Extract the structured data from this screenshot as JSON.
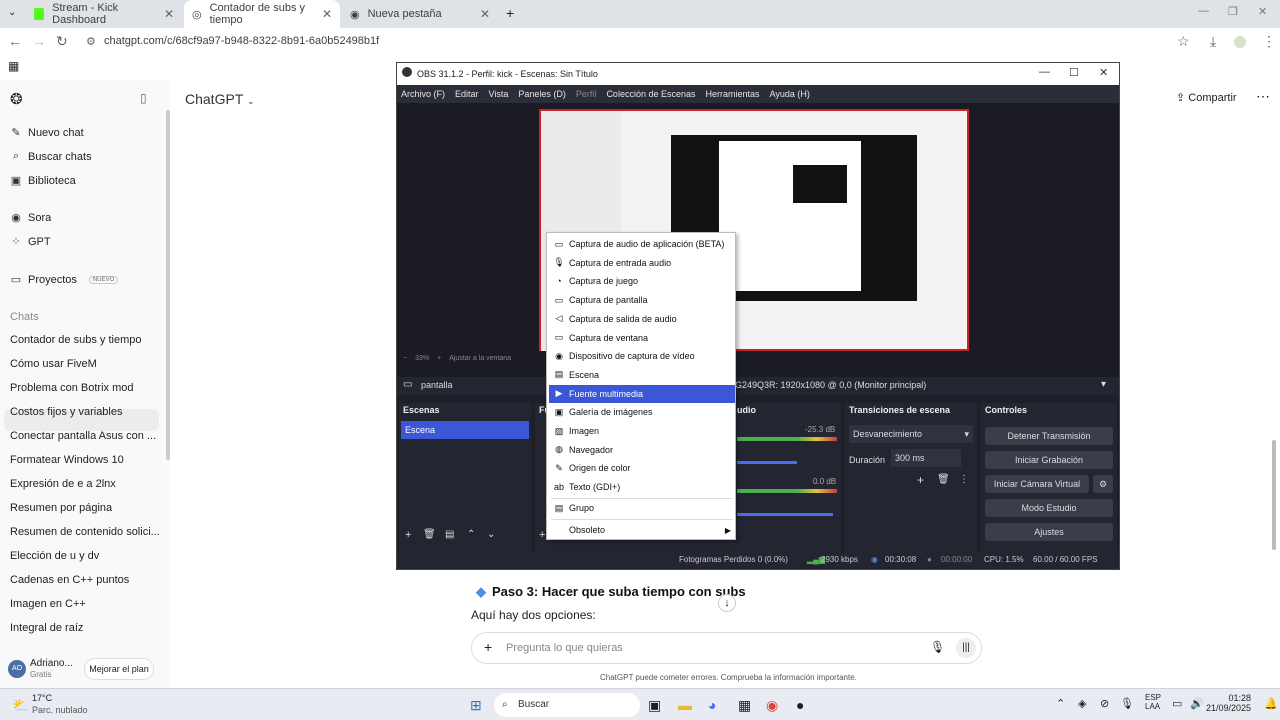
{
  "browser": {
    "tabs": [
      {
        "label": "Stream - Kick Dashboard"
      },
      {
        "label": "Contador de subs y tiempo"
      },
      {
        "label": "Nueva pestaña"
      }
    ],
    "url": "chatgpt.com/c/68cf9a97-b948-8322-8b91-6a0b52498b1f"
  },
  "chatgpt": {
    "title": "ChatGPT",
    "share": "Compartir",
    "sidebar": {
      "new_chat": "Nuevo chat",
      "search_chats": "Buscar chats",
      "library": "Biblioteca",
      "sora": "Sora",
      "gpt": "GPT",
      "projects": "Proyectos",
      "projects_badge": "NUEVO",
      "chats_heading": "Chats",
      "chats": [
        "Contador de subs y tiempo",
        "Cómo usar FiveM",
        "Problema con Botrix mod",
        "Costos fijos y variables",
        "Conectar pantalla Asus con ...",
        "Formatear Windows 10",
        "Expresión de e a 2lnx",
        "Resumen por página",
        "Resumen de contenido solici...",
        "Elección de u y dv",
        "Cadenas en C++ puntos",
        "Imagen en C++",
        "Integral de raíz"
      ],
      "user_initials": "AO",
      "user_name": "Adriano...",
      "user_plan": "Gratis",
      "upgrade": "Mejorar el plan"
    },
    "content": {
      "step_heading": "Paso 3: Hacer que suba tiempo con subs",
      "options_text": "Aquí hay dos opciones:",
      "composer_placeholder": "Pregunta lo que quieras",
      "disclaimer": "ChatGPT puede cometer errores. Comprueba la información importante."
    }
  },
  "obs": {
    "title": "OBS 31.1.2 - Perfil: kick - Escenas: Sin Título",
    "menu": [
      "Archivo (F)",
      "Editar",
      "Vista",
      "Paneles (D)",
      "Perfil",
      "Colección de Escenas",
      "Herramientas",
      "Ayuda (H)"
    ],
    "zoom": "33%",
    "fit": "Ajustar a la ventana",
    "source_name": "pantalla",
    "monitor": "G249Q3R: 1920x1080 @ 0,0 (Monitor principal)",
    "scenes_header": "Escenas",
    "scene_item": "Escena",
    "sources_header": "Fu",
    "audio_header": "udio",
    "audio_db1": "-25.3 dB",
    "audio_db2": "0.0 dB",
    "transitions_header": "Transiciones de escena",
    "transition": "Desvanecimiento",
    "duration_label": "Duración",
    "duration_value": "300 ms",
    "controls_header": "Controles",
    "controls": {
      "stop_stream": "Detener Transmisión",
      "start_recording": "Iniciar Grabación",
      "virtual_cam": "Iniciar Cámara Virtual",
      "studio_mode": "Modo Estudio",
      "settings": "Ajustes"
    },
    "status": {
      "dropped": "Fotogramas Perdidos 0 (0.0%)",
      "bitrate": "2930 kbps",
      "stream_time": "00:30:08",
      "rec_time": "00:00:00",
      "cpu": "CPU: 1.5%",
      "fps": "60.00 / 60.00 FPS"
    }
  },
  "context_menu": {
    "items": [
      {
        "label": "Captura de audio de aplicación (BETA)",
        "icon": "app-audio-icon"
      },
      {
        "label": "Captura de entrada audio",
        "icon": "mic-icon"
      },
      {
        "label": "Captura de juego",
        "icon": "gamepad-icon"
      },
      {
        "label": "Captura de pantalla",
        "icon": "monitor-icon"
      },
      {
        "label": "Captura de salida de audio",
        "icon": "speaker-icon"
      },
      {
        "label": "Captura de ventana",
        "icon": "window-icon"
      },
      {
        "label": "Dispositivo de captura de vídeo",
        "icon": "camera-icon"
      },
      {
        "label": "Escena",
        "icon": "scene-icon"
      },
      {
        "label": "Fuente multimedia",
        "icon": "play-icon"
      },
      {
        "label": "Galería de imágenes",
        "icon": "gallery-icon"
      },
      {
        "label": "Imagen",
        "icon": "image-icon"
      },
      {
        "label": "Navegador",
        "icon": "globe-icon"
      },
      {
        "label": "Origen de color",
        "icon": "brush-icon"
      },
      {
        "label": "Texto (GDI+)",
        "icon": "text-icon"
      }
    ],
    "group": "Grupo",
    "deprecated": "Obsoleto"
  },
  "taskbar": {
    "temp": "17°C",
    "weather": "Parc. nublado",
    "search": "Buscar",
    "lang1": "ESP",
    "lang2": "LAA",
    "time": "01:28",
    "date": "21/09/2025"
  }
}
